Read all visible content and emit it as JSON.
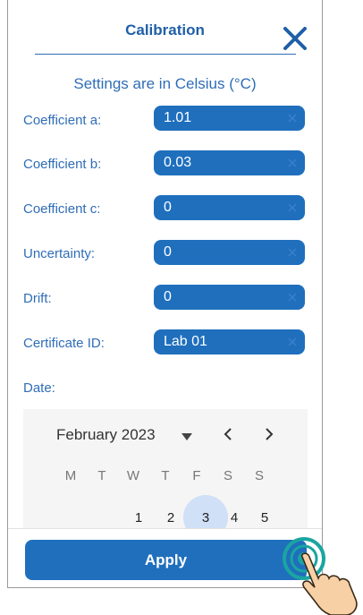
{
  "header": {
    "title": "Calibration",
    "close_icon": "close-icon"
  },
  "subtitle": "Settings are in Celsius (°C)",
  "fields": [
    {
      "label": "Coefficient a:",
      "value": "1.01"
    },
    {
      "label": "Coefficient b:",
      "value": "0.03"
    },
    {
      "label": "Coefficient c:",
      "value": "0"
    },
    {
      "label": "Uncertainty:",
      "value": "0"
    },
    {
      "label": "Drift:",
      "value": "0"
    },
    {
      "label": "Certificate ID:",
      "value": "Lab 01"
    }
  ],
  "date_label": "Date:",
  "calendar": {
    "month_label": "February 2023",
    "weekdays": [
      "M",
      "T",
      "W",
      "T",
      "F",
      "S",
      "S"
    ],
    "visible_days": [
      "1",
      "2",
      "3",
      "4",
      "5"
    ],
    "selected_day": "3"
  },
  "apply_label": "Apply",
  "colors": {
    "primary": "#1f6fbd",
    "text_blue": "#2f6db7",
    "selected_day_bg": "#cfe0f7"
  }
}
